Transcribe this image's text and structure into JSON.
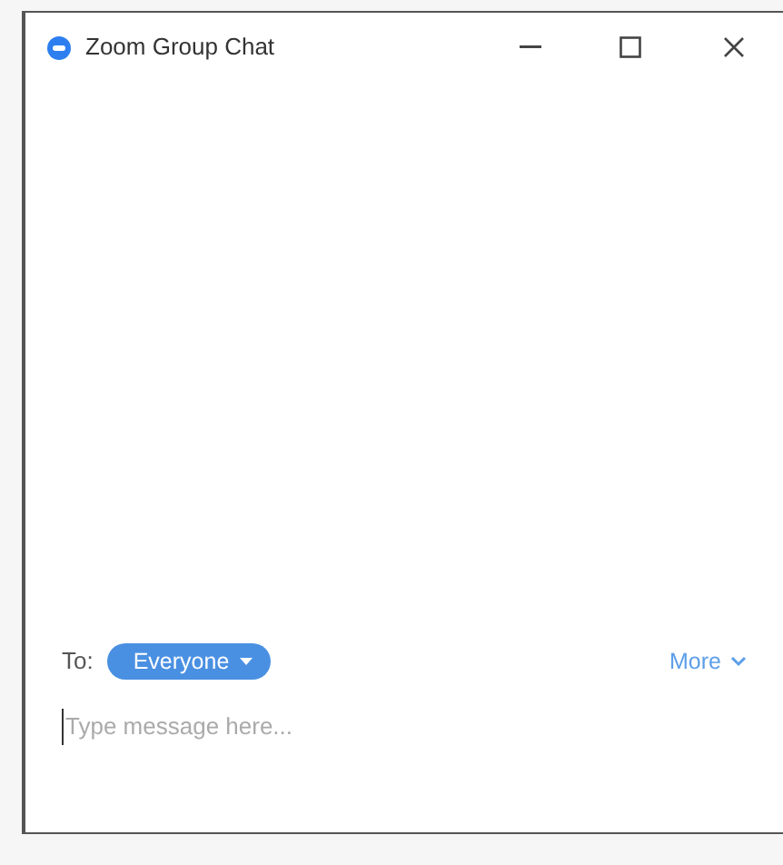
{
  "window": {
    "title": "Zoom Group Chat"
  },
  "recipient": {
    "label": "To:",
    "value": "Everyone"
  },
  "more": {
    "label": "More"
  },
  "message": {
    "placeholder": "Type message here..."
  }
}
